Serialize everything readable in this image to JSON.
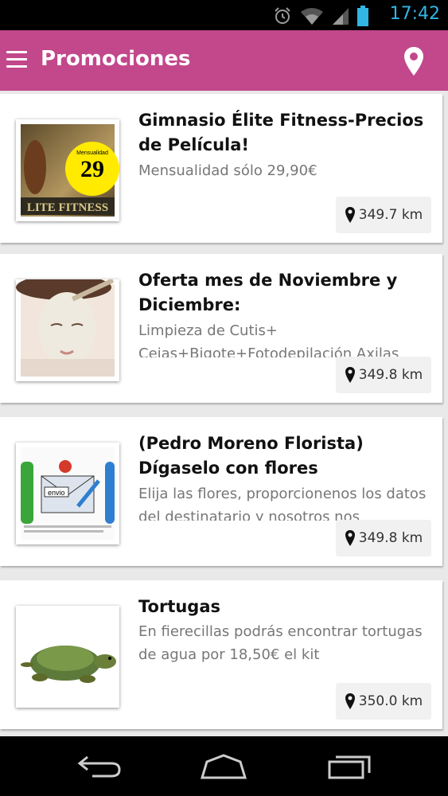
{
  "status": {
    "time": "17:42"
  },
  "app_bar": {
    "title": "Promociones"
  },
  "promotions": [
    {
      "title": "Gimnasio Élite Fitness-Precios de Película!",
      "description": "Mensualidad sólo 29,90€",
      "distance": "349.7 km",
      "image": "gym-promo-image"
    },
    {
      "title": "Oferta mes de Noviembre y Diciembre:",
      "description": "Limpieza de Cutis+ Cejas+Bigote+Fotodepilación Axilas",
      "distance": "349.8 km",
      "image": "facial-treatment-image"
    },
    {
      "title": "(Pedro Moreno Florista) Dígaselo con flores",
      "description": "Elija las flores, proporcionenos los datos del destinatario y nosotros nos",
      "distance": "349.8 km",
      "image": "flower-delivery-image"
    },
    {
      "title": "Tortugas",
      "description": "En fierecillas podrás encontrar tortugas de agua por 18,50€ el kit",
      "distance": "350.0 km",
      "image": "turtle-image"
    }
  ],
  "thumb_text": {
    "gym_number": "29",
    "gym_monthly": "Mensualidad",
    "gym_banner": "LITE FITNESS",
    "flower_envio": "envio"
  },
  "colors": {
    "app_bar": "#c2478b",
    "status_time": "#33b5e5"
  }
}
